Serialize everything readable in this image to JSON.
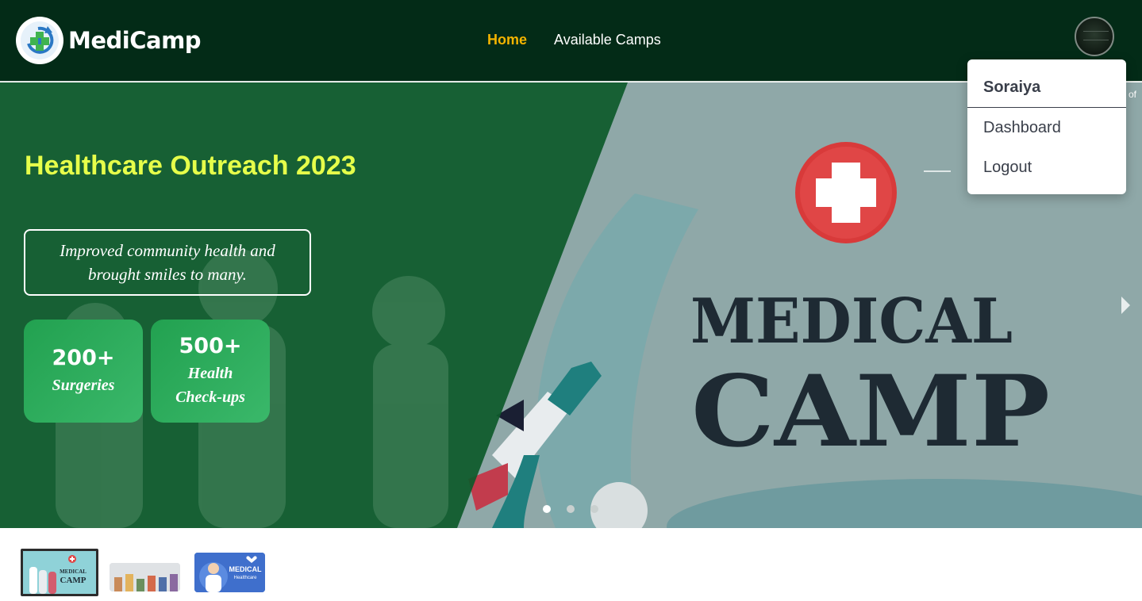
{
  "navbar": {
    "brand": "MediCamp",
    "links": [
      {
        "label": "Home",
        "active": true
      },
      {
        "label": "Available Camps",
        "active": false
      }
    ],
    "accent_color": "#f4b400",
    "background_color": "#032b17"
  },
  "user_menu": {
    "name": "Soraiya",
    "items": [
      "Dashboard",
      "Logout"
    ]
  },
  "hero": {
    "title": "Healthcare Outreach 2023",
    "quote": "Improved community health and brought smiles to many.",
    "stats": [
      {
        "value": "200+",
        "label": "Surgeries"
      },
      {
        "value": "500+",
        "label": "Health Check-ups"
      }
    ],
    "banner_line1": "MEDICAL",
    "banner_line2": "CAMP",
    "slide_counter": "1 of 3",
    "active_slide": 1,
    "slide_count": 3
  },
  "thumbnails": [
    {
      "line1": "MEDICAL",
      "line2": "CAMP"
    },
    {},
    {
      "line1": "MEDICAL",
      "line2": "Healthcare"
    }
  ]
}
